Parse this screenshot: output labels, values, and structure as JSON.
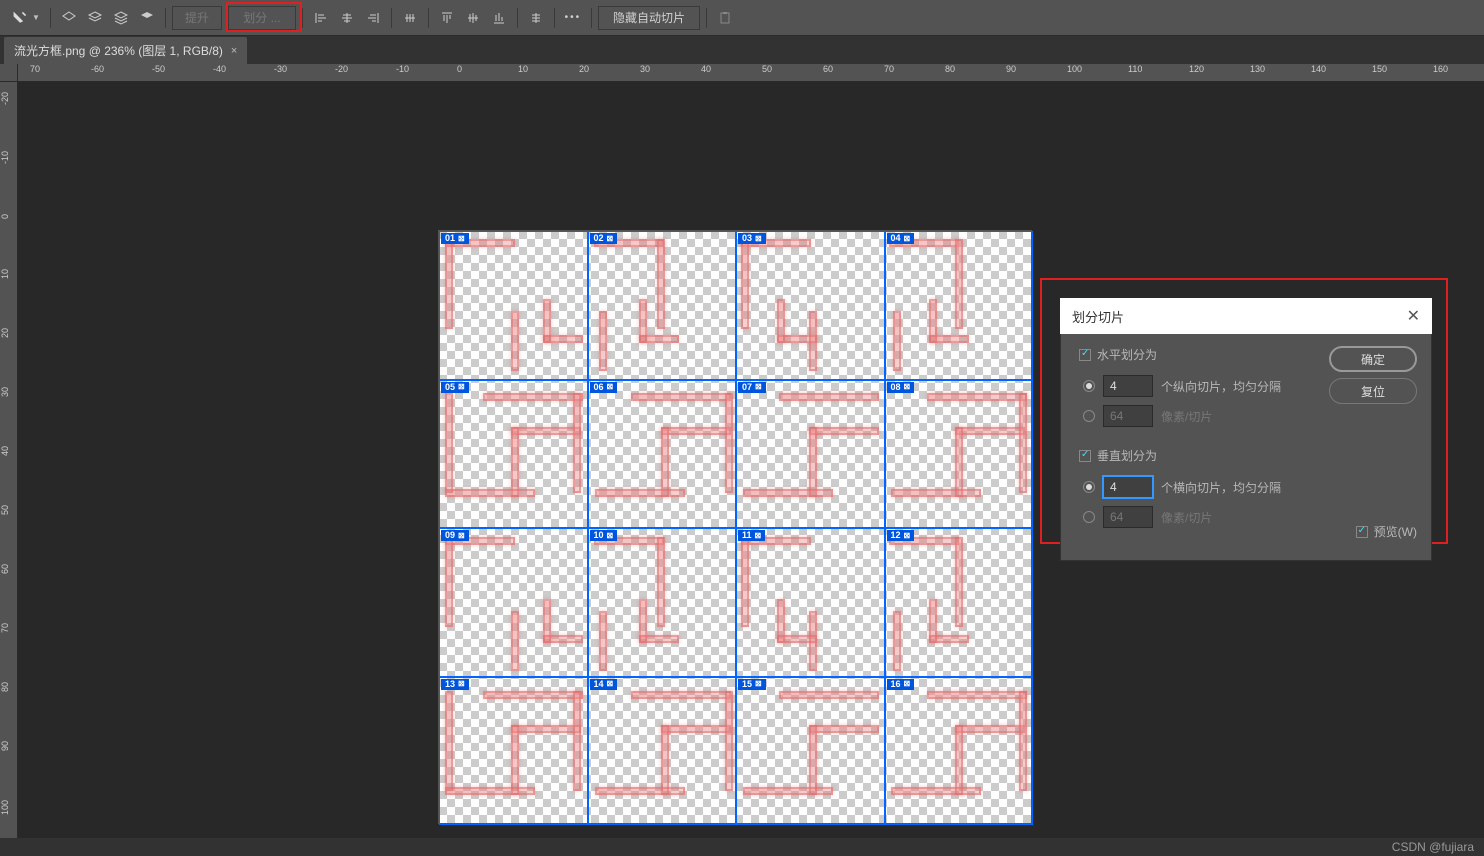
{
  "toolbar": {
    "promote": "提升",
    "divide": "划分 ...",
    "hide_auto_slice": "隐藏自动切片",
    "more": "•••"
  },
  "tab": {
    "title": "流光方框.png @ 236% (图层 1, RGB/8)",
    "close": "×"
  },
  "ruler_h": [
    "70",
    "-60",
    "-50",
    "-40",
    "-30",
    "-20",
    "-10",
    "0",
    "10",
    "20",
    "30",
    "40",
    "50",
    "60",
    "70",
    "80",
    "90",
    "100",
    "110",
    "120",
    "130",
    "140",
    "150",
    "160"
  ],
  "ruler_v": [
    "-20",
    "-10",
    "0",
    "10",
    "20",
    "30",
    "40",
    "50",
    "60",
    "70",
    "80",
    "90",
    "100"
  ],
  "slices": [
    {
      "n": "01",
      "r": 0,
      "c": 0
    },
    {
      "n": "02",
      "r": 0,
      "c": 1
    },
    {
      "n": "03",
      "r": 0,
      "c": 2
    },
    {
      "n": "04",
      "r": 0,
      "c": 3
    },
    {
      "n": "05",
      "r": 1,
      "c": 0
    },
    {
      "n": "06",
      "r": 1,
      "c": 1
    },
    {
      "n": "07",
      "r": 1,
      "c": 2
    },
    {
      "n": "08",
      "r": 1,
      "c": 3
    },
    {
      "n": "09",
      "r": 2,
      "c": 0
    },
    {
      "n": "10",
      "r": 2,
      "c": 1
    },
    {
      "n": "11",
      "r": 2,
      "c": 2
    },
    {
      "n": "12",
      "r": 2,
      "c": 3
    },
    {
      "n": "13",
      "r": 3,
      "c": 0
    },
    {
      "n": "14",
      "r": 3,
      "c": 1
    },
    {
      "n": "15",
      "r": 3,
      "c": 2
    },
    {
      "n": "16",
      "r": 3,
      "c": 3
    }
  ],
  "dialog": {
    "title": "划分切片",
    "horizontal_label": "水平划分为",
    "h_count": "4",
    "h_count_suffix": "个纵向切片，均匀分隔",
    "h_px": "64",
    "h_px_suffix": "像素/切片",
    "vertical_label": "垂直划分为",
    "v_count": "4",
    "v_count_suffix": "个横向切片，均匀分隔",
    "v_px": "64",
    "v_px_suffix": "像素/切片",
    "ok": "确定",
    "reset": "复位",
    "preview": "预览(W)"
  },
  "watermark": "CSDN @fujiara"
}
